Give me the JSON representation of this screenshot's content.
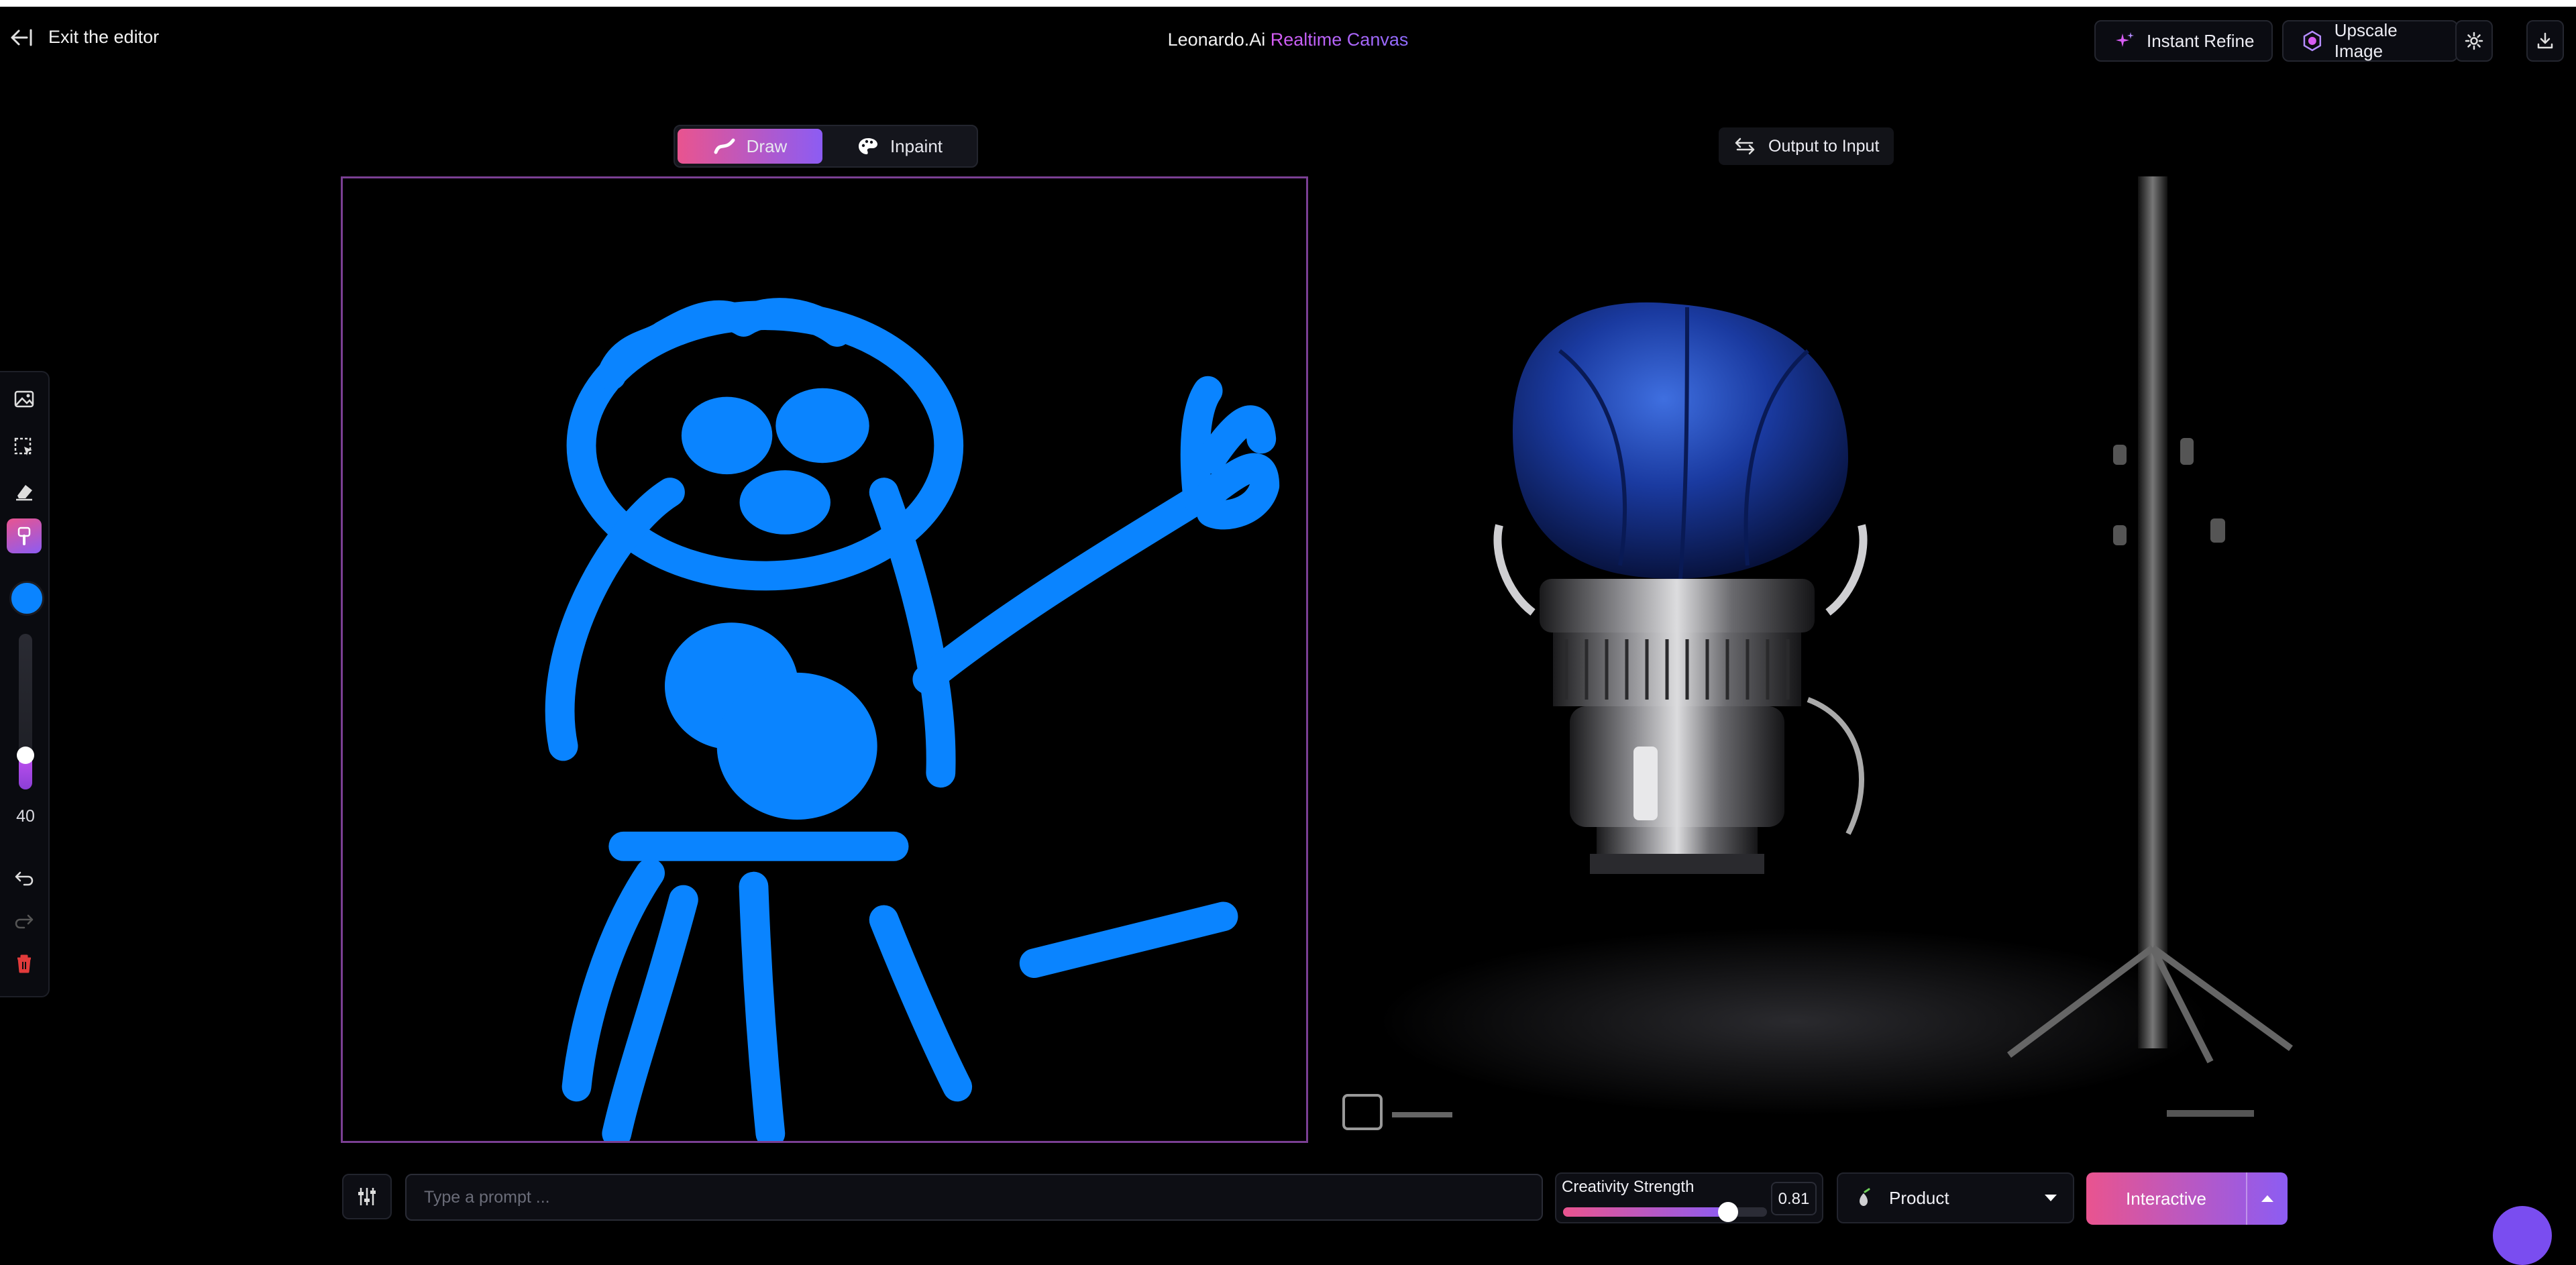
{
  "header": {
    "exit_label": "Exit the editor",
    "title_brand": "Leonardo.Ai",
    "title_accent": "Realtime Canvas",
    "instant_refine": "Instant Refine",
    "upscale_image": "Upscale Image"
  },
  "modes": {
    "draw": "Draw",
    "inpaint": "Inpaint",
    "active": "Draw"
  },
  "output_to_input": "Output to Input",
  "toolbar": {
    "tools": [
      "image-icon",
      "select-icon",
      "eraser-icon",
      "brush-icon",
      "undo-icon",
      "redo-icon",
      "trash-icon"
    ],
    "active_tool": "brush-icon",
    "brush_color": "#0a84ff",
    "brush_size": "40",
    "brush_size_level": 0.22
  },
  "bottom": {
    "prompt_placeholder": "Type a prompt ...",
    "prompt_value": "",
    "creativity_label": "Creativity Strength",
    "creativity_value": "0.81",
    "style": "Product",
    "generate_mode": "Interactive"
  },
  "colors": {
    "accent_gradient_start": "#e9548f",
    "accent_gradient_end": "#8c5cf3",
    "stroke_blue": "#0a84ff",
    "background": "#000000"
  }
}
